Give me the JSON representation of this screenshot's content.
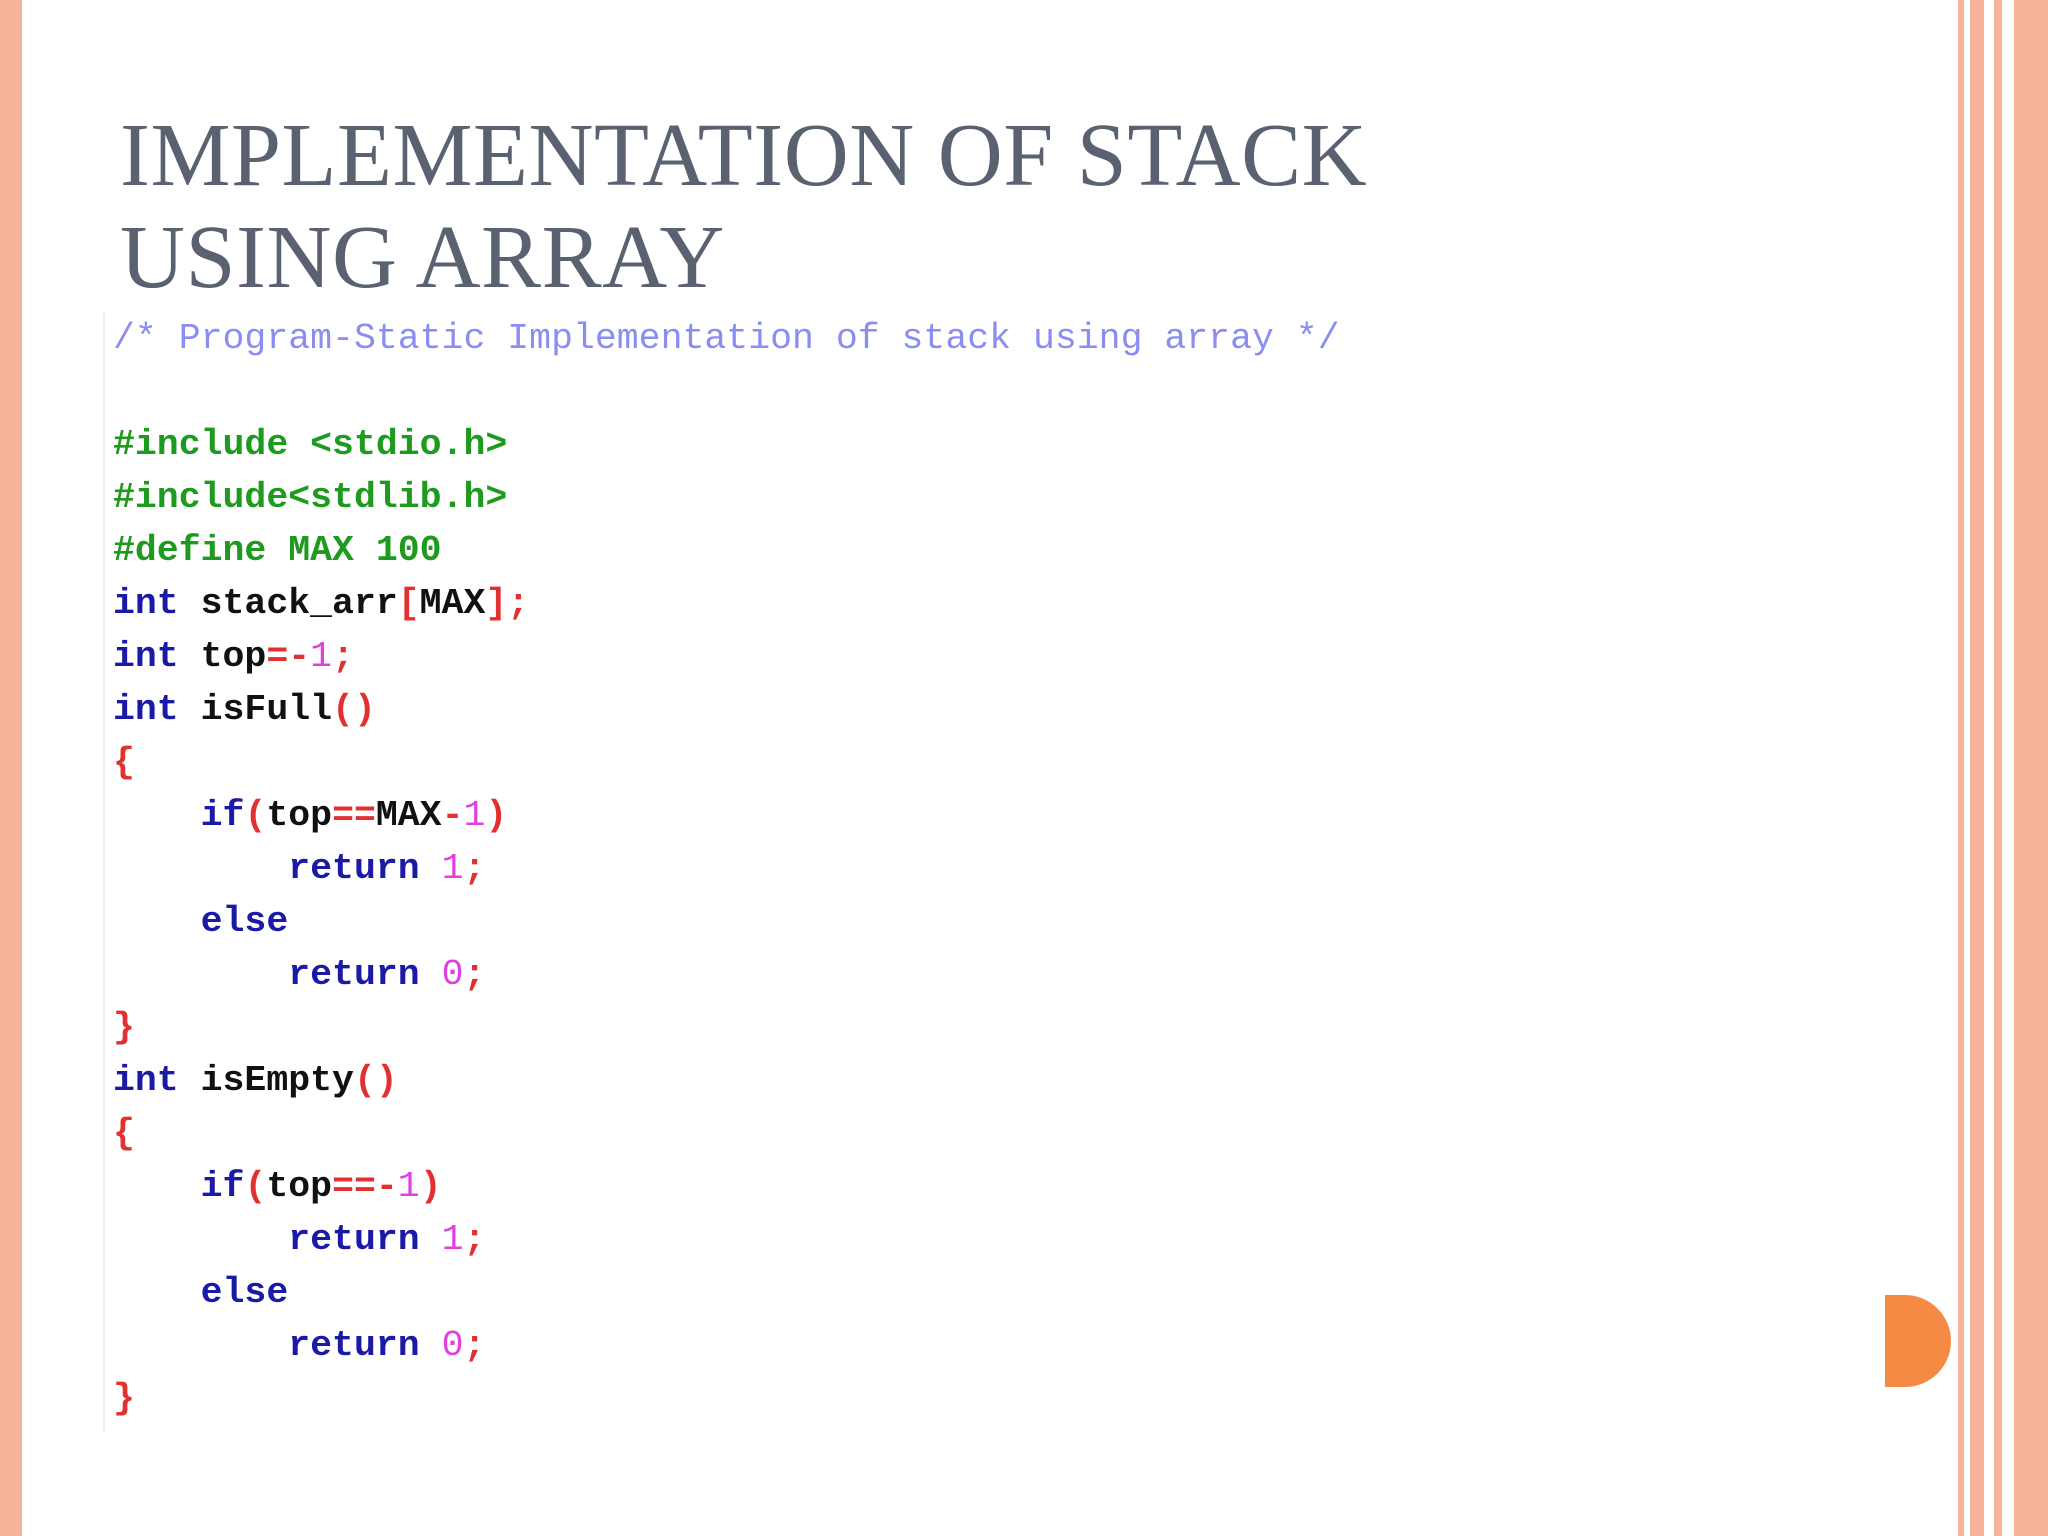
{
  "slide": {
    "title": "IMPLEMENTATION OF STACK USING ARRAY",
    "code": [
      [
        {
          "t": "/* Program-Static Implementation of stack using array */",
          "c": "comment"
        }
      ],
      [],
      [
        {
          "t": "#include <stdio.h>",
          "c": "pp"
        }
      ],
      [
        {
          "t": "#include<stdlib.h>",
          "c": "pp"
        }
      ],
      [
        {
          "t": "#define MAX 100",
          "c": "pp"
        }
      ],
      [
        {
          "t": "int",
          "c": "kw"
        },
        {
          "t": " stack_arr",
          "c": "plain"
        },
        {
          "t": "[",
          "c": "op"
        },
        {
          "t": "MAX",
          "c": "plain"
        },
        {
          "t": "];",
          "c": "op"
        }
      ],
      [
        {
          "t": "int",
          "c": "kw"
        },
        {
          "t": " top",
          "c": "plain"
        },
        {
          "t": "=-",
          "c": "op"
        },
        {
          "t": "1",
          "c": "num"
        },
        {
          "t": ";",
          "c": "op"
        }
      ],
      [
        {
          "t": "int",
          "c": "kw"
        },
        {
          "t": " isFull",
          "c": "plain"
        },
        {
          "t": "()",
          "c": "op"
        }
      ],
      [
        {
          "t": "{",
          "c": "op"
        }
      ],
      [
        {
          "t": "    ",
          "c": "plain"
        },
        {
          "t": "if",
          "c": "kw"
        },
        {
          "t": "(",
          "c": "op"
        },
        {
          "t": "top",
          "c": "plain"
        },
        {
          "t": "==",
          "c": "op"
        },
        {
          "t": "MAX",
          "c": "plain"
        },
        {
          "t": "-",
          "c": "op"
        },
        {
          "t": "1",
          "c": "num"
        },
        {
          "t": ")",
          "c": "op"
        }
      ],
      [
        {
          "t": "        ",
          "c": "plain"
        },
        {
          "t": "return",
          "c": "kw"
        },
        {
          "t": " ",
          "c": "plain"
        },
        {
          "t": "1",
          "c": "num"
        },
        {
          "t": ";",
          "c": "op"
        }
      ],
      [
        {
          "t": "    ",
          "c": "plain"
        },
        {
          "t": "else",
          "c": "kw"
        }
      ],
      [
        {
          "t": "        ",
          "c": "plain"
        },
        {
          "t": "return",
          "c": "kw"
        },
        {
          "t": " ",
          "c": "plain"
        },
        {
          "t": "0",
          "c": "num"
        },
        {
          "t": ";",
          "c": "op"
        }
      ],
      [
        {
          "t": "}",
          "c": "op"
        }
      ],
      [
        {
          "t": "int",
          "c": "kw"
        },
        {
          "t": " isEmpty",
          "c": "plain"
        },
        {
          "t": "()",
          "c": "op"
        }
      ],
      [
        {
          "t": "{",
          "c": "op"
        }
      ],
      [
        {
          "t": "    ",
          "c": "plain"
        },
        {
          "t": "if",
          "c": "kw"
        },
        {
          "t": "(",
          "c": "op"
        },
        {
          "t": "top",
          "c": "plain"
        },
        {
          "t": "==-",
          "c": "op"
        },
        {
          "t": "1",
          "c": "num"
        },
        {
          "t": ")",
          "c": "op"
        }
      ],
      [
        {
          "t": "        ",
          "c": "plain"
        },
        {
          "t": "return",
          "c": "kw"
        },
        {
          "t": " ",
          "c": "plain"
        },
        {
          "t": "1",
          "c": "num"
        },
        {
          "t": ";",
          "c": "op"
        }
      ],
      [
        {
          "t": "    ",
          "c": "plain"
        },
        {
          "t": "else",
          "c": "kw"
        }
      ],
      [
        {
          "t": "        ",
          "c": "plain"
        },
        {
          "t": "return",
          "c": "kw"
        },
        {
          "t": " ",
          "c": "plain"
        },
        {
          "t": "0",
          "c": "num"
        },
        {
          "t": ";",
          "c": "op"
        }
      ],
      [
        {
          "t": "}",
          "c": "op"
        }
      ]
    ]
  },
  "theme": {
    "title_color": "#5a6272",
    "border_color": "#f7b49a",
    "accent_color": "#f58a45",
    "right_stripe_colors": [
      "#f7b49a",
      "#ffffff",
      "#f7b49a",
      "#ffffff",
      "#f7b49a",
      "#ffffff",
      "#f7b49a"
    ]
  }
}
